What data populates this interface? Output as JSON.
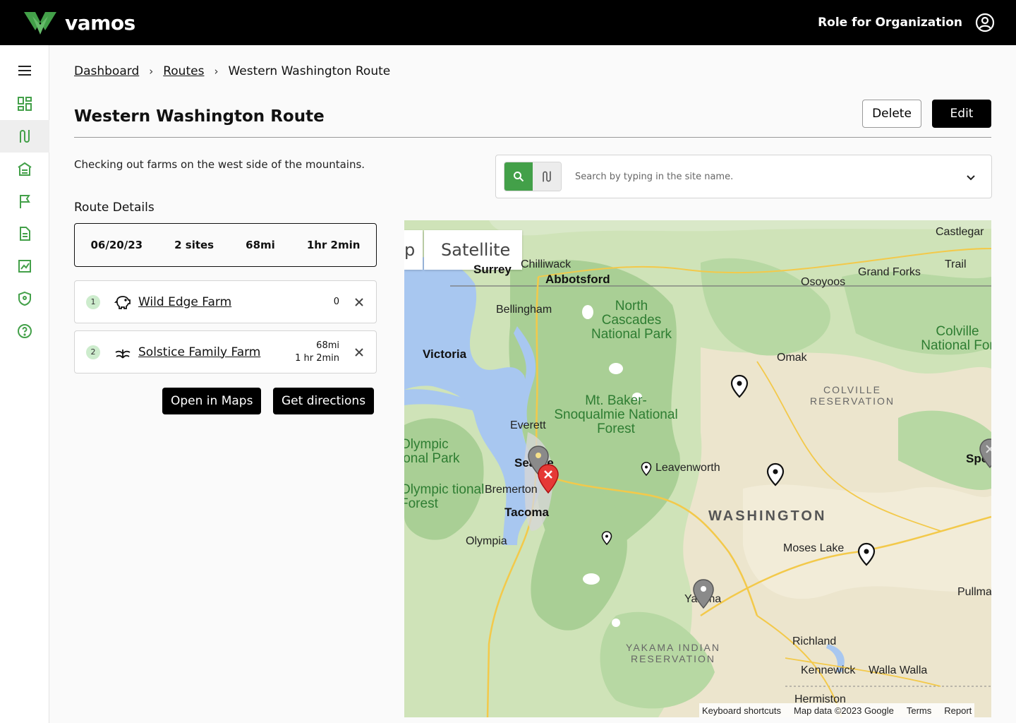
{
  "header": {
    "brand": "vamos",
    "role": "Role for Organization"
  },
  "sidebar": {
    "items": [
      "menu",
      "dashboard",
      "routes",
      "sites",
      "flag",
      "reports",
      "analytics",
      "security",
      "help"
    ]
  },
  "breadcrumb": {
    "dashboard": "Dashboard",
    "routes": "Routes",
    "current": "Western Washington Route"
  },
  "page": {
    "title": "Western Washington Route",
    "delete_label": "Delete",
    "edit_label": "Edit",
    "description": "Checking out farms on the west side of the mountains.",
    "route_details_label": "Route Details"
  },
  "summary": {
    "date": "06/20/23",
    "sites": "2 sites",
    "distance": "68mi",
    "duration": "1hr 2min"
  },
  "sites": [
    {
      "num": "1",
      "name": "Wild Edge Farm",
      "icon": "pig-icon",
      "meta1": "0",
      "meta2": ""
    },
    {
      "num": "2",
      "name": "Solstice Family Farm",
      "icon": "sprout-icon",
      "meta1": "68mi",
      "meta2": "1 hr 2min"
    }
  ],
  "actions": {
    "open_maps": "Open in Maps",
    "directions": "Get directions"
  },
  "search": {
    "placeholder": "Search by typing in the site name."
  },
  "map": {
    "tab_left": "p",
    "tab_satellite": "Satellite",
    "labels": {
      "castlegar": "Castlegar",
      "trail": "Trail",
      "grand_forks": "Grand Forks",
      "osoyoos": "Osoyoos",
      "chilliwack": "Chilliwack",
      "abbotsford": "Abbotsford",
      "surrey": "Surrey",
      "bellingham": "Bellingham",
      "victoria": "Victoria",
      "omak": "Omak",
      "everett": "Everett",
      "seattle": "Seattle",
      "bremerton": "Bremerton",
      "tacoma": "Tacoma",
      "olympia": "Olympia",
      "leavenworth": "Leavenworth",
      "moses_lake": "Moses Lake",
      "yakima": "Yakima",
      "richland": "Richland",
      "kennewick": "Kennewick",
      "walla_walla": "Walla Walla",
      "hermiston": "Hermiston",
      "spokane": "Spok",
      "pullman": "Pullma",
      "north_cascades": "North Cascades National Park",
      "colville_nf": "Colville National For",
      "baker": "Mt. Baker-Snoqualmie National Forest",
      "olympic_np": "Olympic ional Park",
      "olympic_nf": "Olympic tional Forest",
      "colville_res": "COLVILLE RESERVATION",
      "washington": "WASHINGTON",
      "yakama_res": "YAKAMA INDIAN RESERVATION"
    },
    "footer": {
      "shortcuts": "Keyboard shortcuts",
      "mapdata": "Map data ©2023 Google",
      "terms": "Terms",
      "report": "Report"
    }
  }
}
